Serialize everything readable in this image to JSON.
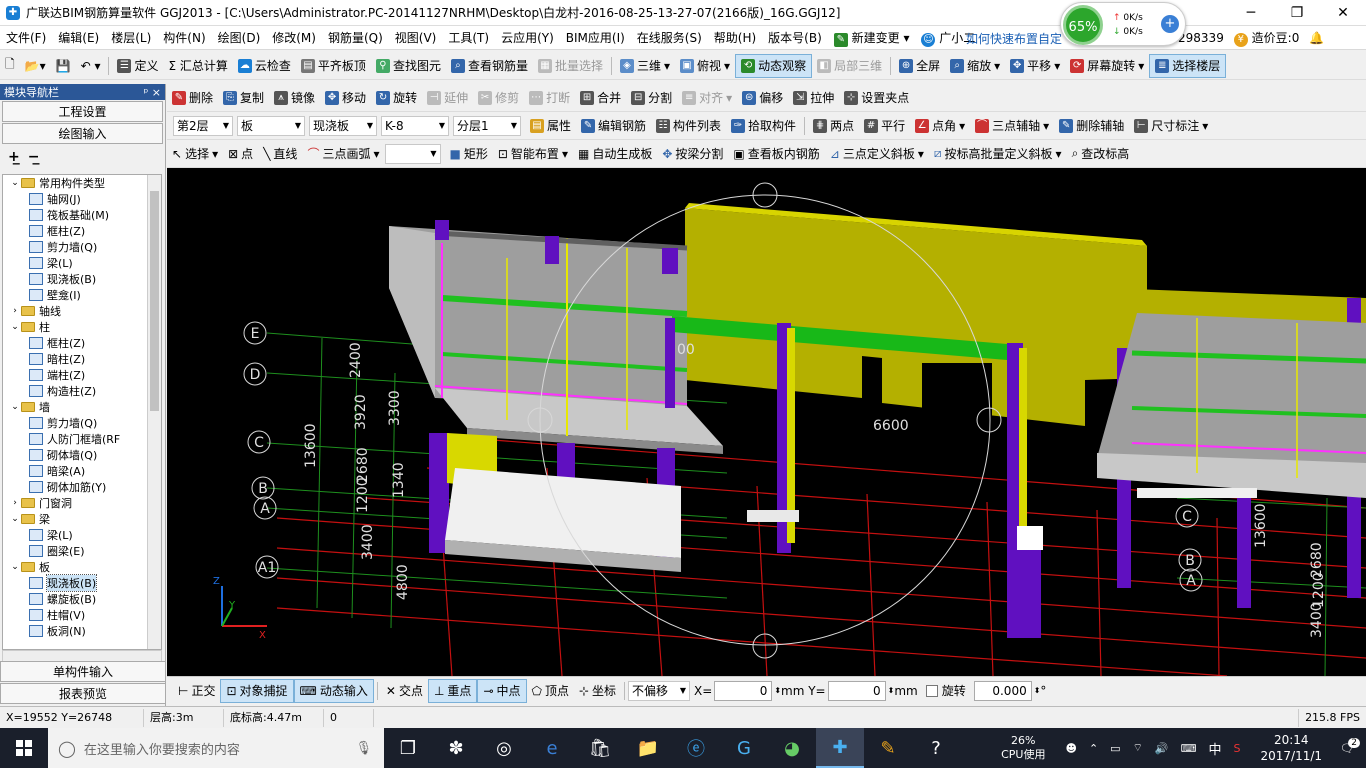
{
  "title": "广联达BIM钢筋算量软件 GGJ2013 - [C:\\Users\\Administrator.PC-20141127NRHM\\Desktop\\白龙村-2016-08-25-13-27-07(2166版)_16G.GGJ12]",
  "network": {
    "percent": "65%",
    "up": "0K/s",
    "down": "0K/s"
  },
  "menu": [
    "文件(F)",
    "编辑(E)",
    "楼层(L)",
    "构件(N)",
    "绘图(D)",
    "修改(M)",
    "钢筋量(Q)",
    "视图(V)",
    "工具(T)",
    "云应用(Y)",
    "BIM应用(I)",
    "在线服务(S)",
    "帮助(H)",
    "版本号(B)",
    "新建变更",
    "广小二"
  ],
  "menu_right": {
    "link": "如何快速布置自定",
    "account": "298339",
    "price": "造价豆:0"
  },
  "toolbar1": [
    "定义",
    "Σ 汇总计算",
    "云检查",
    "平齐板顶",
    "查找图元",
    "查看钢筋量",
    "批量选择",
    "三维",
    "俯视",
    "动态观察",
    "局部三维",
    "全屏",
    "缩放",
    "平移",
    "屏幕旋转",
    "选择楼层"
  ],
  "toolbar2": [
    "删除",
    "复制",
    "镜像",
    "移动",
    "旋转",
    "延伸",
    "修剪",
    "打断",
    "合并",
    "分割",
    "对齐",
    "偏移",
    "拉伸",
    "设置夹点"
  ],
  "toolbar3": {
    "floor": "第2层",
    "type": "板",
    "subtype": "现浇板",
    "name": "K-8",
    "layer": "分层1",
    "buttons": [
      "属性",
      "编辑钢筋",
      "构件列表",
      "拾取构件",
      "两点",
      "平行",
      "点角",
      "三点辅轴",
      "删除辅轴",
      "尺寸标注"
    ]
  },
  "toolbar4": [
    "选择",
    "点",
    "直线",
    "三点画弧",
    "矩形",
    "智能布置",
    "自动生成板",
    "按梁分割",
    "查看板内钢筋",
    "三点定义斜板",
    "按标高批量定义斜板",
    "查改标高"
  ],
  "sidebar": {
    "header": "模块导航栏",
    "pin": "ᵖ ×",
    "tab1": "工程设置",
    "tab2": "绘图输入",
    "bottom1": "单构件输入",
    "bottom2": "报表预览",
    "tree": [
      {
        "level": 0,
        "label": "常用构件类型",
        "folder": true,
        "open": true
      },
      {
        "level": 1,
        "label": "轴网(J)"
      },
      {
        "level": 1,
        "label": "筏板基础(M)"
      },
      {
        "level": 1,
        "label": "框柱(Z)"
      },
      {
        "level": 1,
        "label": "剪力墙(Q)"
      },
      {
        "level": 1,
        "label": "梁(L)"
      },
      {
        "level": 1,
        "label": "现浇板(B)"
      },
      {
        "level": 1,
        "label": "壁龛(I)"
      },
      {
        "level": 0,
        "label": "轴线",
        "folder": true,
        "open": false
      },
      {
        "level": 0,
        "label": "柱",
        "folder": true,
        "open": true
      },
      {
        "level": 1,
        "label": "框柱(Z)"
      },
      {
        "level": 1,
        "label": "暗柱(Z)"
      },
      {
        "level": 1,
        "label": "端柱(Z)"
      },
      {
        "level": 1,
        "label": "构造柱(Z)"
      },
      {
        "level": 0,
        "label": "墙",
        "folder": true,
        "open": true
      },
      {
        "level": 1,
        "label": "剪力墙(Q)"
      },
      {
        "level": 1,
        "label": "人防门框墙(RF"
      },
      {
        "level": 1,
        "label": "砌体墙(Q)"
      },
      {
        "level": 1,
        "label": "暗梁(A)"
      },
      {
        "level": 1,
        "label": "砌体加筋(Y)"
      },
      {
        "level": 0,
        "label": "门窗洞",
        "folder": true,
        "open": false
      },
      {
        "level": 0,
        "label": "梁",
        "folder": true,
        "open": true
      },
      {
        "level": 1,
        "label": "梁(L)"
      },
      {
        "level": 1,
        "label": "圈梁(E)"
      },
      {
        "level": 0,
        "label": "板",
        "folder": true,
        "open": true
      },
      {
        "level": 1,
        "label": "现浇板(B)",
        "selected": true
      },
      {
        "level": 1,
        "label": "螺旋板(B)"
      },
      {
        "level": 1,
        "label": "柱帽(V)"
      },
      {
        "level": 1,
        "label": "板洞(N)"
      }
    ]
  },
  "viewport": {
    "axis_labels_left": [
      "E",
      "D",
      "C",
      "B",
      "A",
      "A1"
    ],
    "axis_labels_right": [
      "C",
      "B",
      "A"
    ],
    "dims_left": [
      "2400",
      "3920",
      "3300",
      "13600",
      "1200",
      "2680",
      "1340",
      "3400",
      "4800"
    ],
    "dims_center": "6600",
    "dim_partial": "00",
    "dims_right": [
      "13600",
      "2680",
      "3400",
      "1200"
    ]
  },
  "snapbar": {
    "buttons": [
      "正交",
      "对象捕捉",
      "动态输入",
      "交点",
      "重点",
      "中点",
      "顶点",
      "坐标"
    ],
    "offset": "不偏移",
    "x_label": "X=",
    "x_val": "0",
    "y_label": "mm Y=",
    "y_val": "0",
    "mm": "mm",
    "rotate": "旋转",
    "rot_val": "0.000",
    "deg": "°"
  },
  "status": {
    "coords": "X=19552 Y=26748",
    "floor_h": "层高:3m",
    "bottom_h": "底标高:4.47m",
    "zero": "0",
    "fps": "215.8 FPS"
  },
  "taskbar": {
    "search": "在这里输入你要搜索的内容",
    "cpu_pct": "26%",
    "cpu_label": "CPU使用",
    "ime": "中",
    "time": "20:14",
    "date": "2017/11/1",
    "notif": "2"
  }
}
